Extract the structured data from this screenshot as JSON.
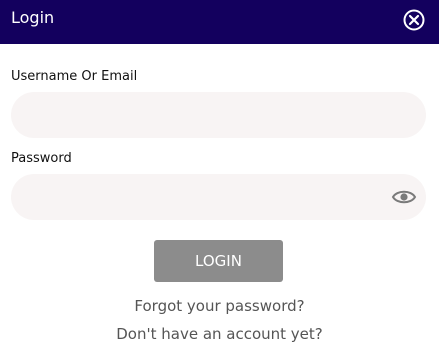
{
  "header": {
    "title": "Login",
    "close_icon": "close-circle-icon",
    "background": "#13005e"
  },
  "form": {
    "username_label": "Username Or Email",
    "username_value": "",
    "password_label": "Password",
    "password_value": "",
    "show_password_icon": "eye-icon",
    "login_button_label": "LOGIN",
    "login_button_color": "#8c8c8c"
  },
  "links": {
    "forgot_password": "Forgot your password?",
    "signup": "Don't have an account yet?"
  }
}
